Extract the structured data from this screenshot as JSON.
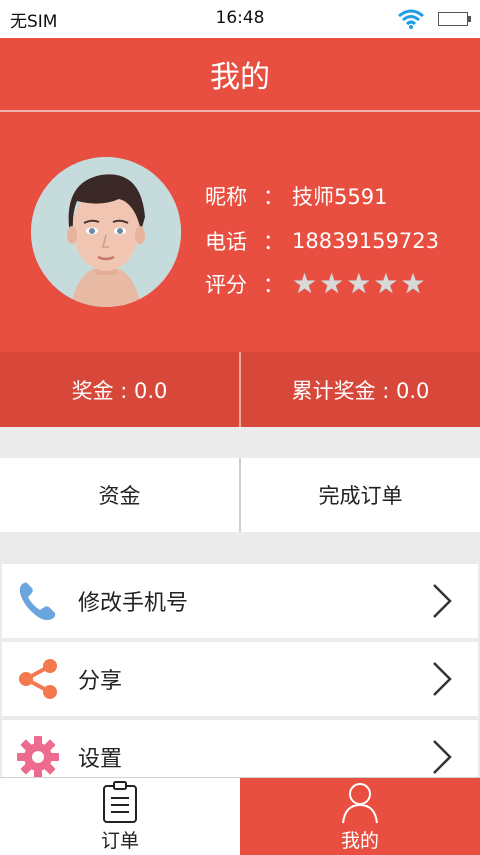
{
  "status_bar": {
    "carrier": "无SIM",
    "time": "16:48"
  },
  "header": {
    "title": "我的"
  },
  "profile": {
    "nickname_label": "昵称",
    "nickname_value": "技师5591",
    "phone_label": "电话",
    "phone_value": "18839159723",
    "rating_label": "评分",
    "separator": "：",
    "rating": 5,
    "rating_max": 5
  },
  "bonus": {
    "bonus": "奖金 : 0.0",
    "total_bonus": "累计奖金 : 0.0"
  },
  "funds": {
    "funds_label": "资金",
    "completed_orders_label": "完成订单"
  },
  "menu": {
    "items": [
      {
        "label": "修改手机号",
        "icon": "phone-icon",
        "color": "#5b9bd5"
      },
      {
        "label": "分享",
        "icon": "share-icon",
        "color": "#f0704a"
      },
      {
        "label": "设置",
        "icon": "gear-icon",
        "color": "#e8668d"
      }
    ]
  },
  "tabbar": {
    "tabs": [
      {
        "label": "订单",
        "icon": "clipboard-icon",
        "active": false
      },
      {
        "label": "我的",
        "icon": "user-icon",
        "active": true
      }
    ]
  },
  "colors": {
    "brand_red": "#e84f40",
    "dark_red": "#d7483a"
  }
}
